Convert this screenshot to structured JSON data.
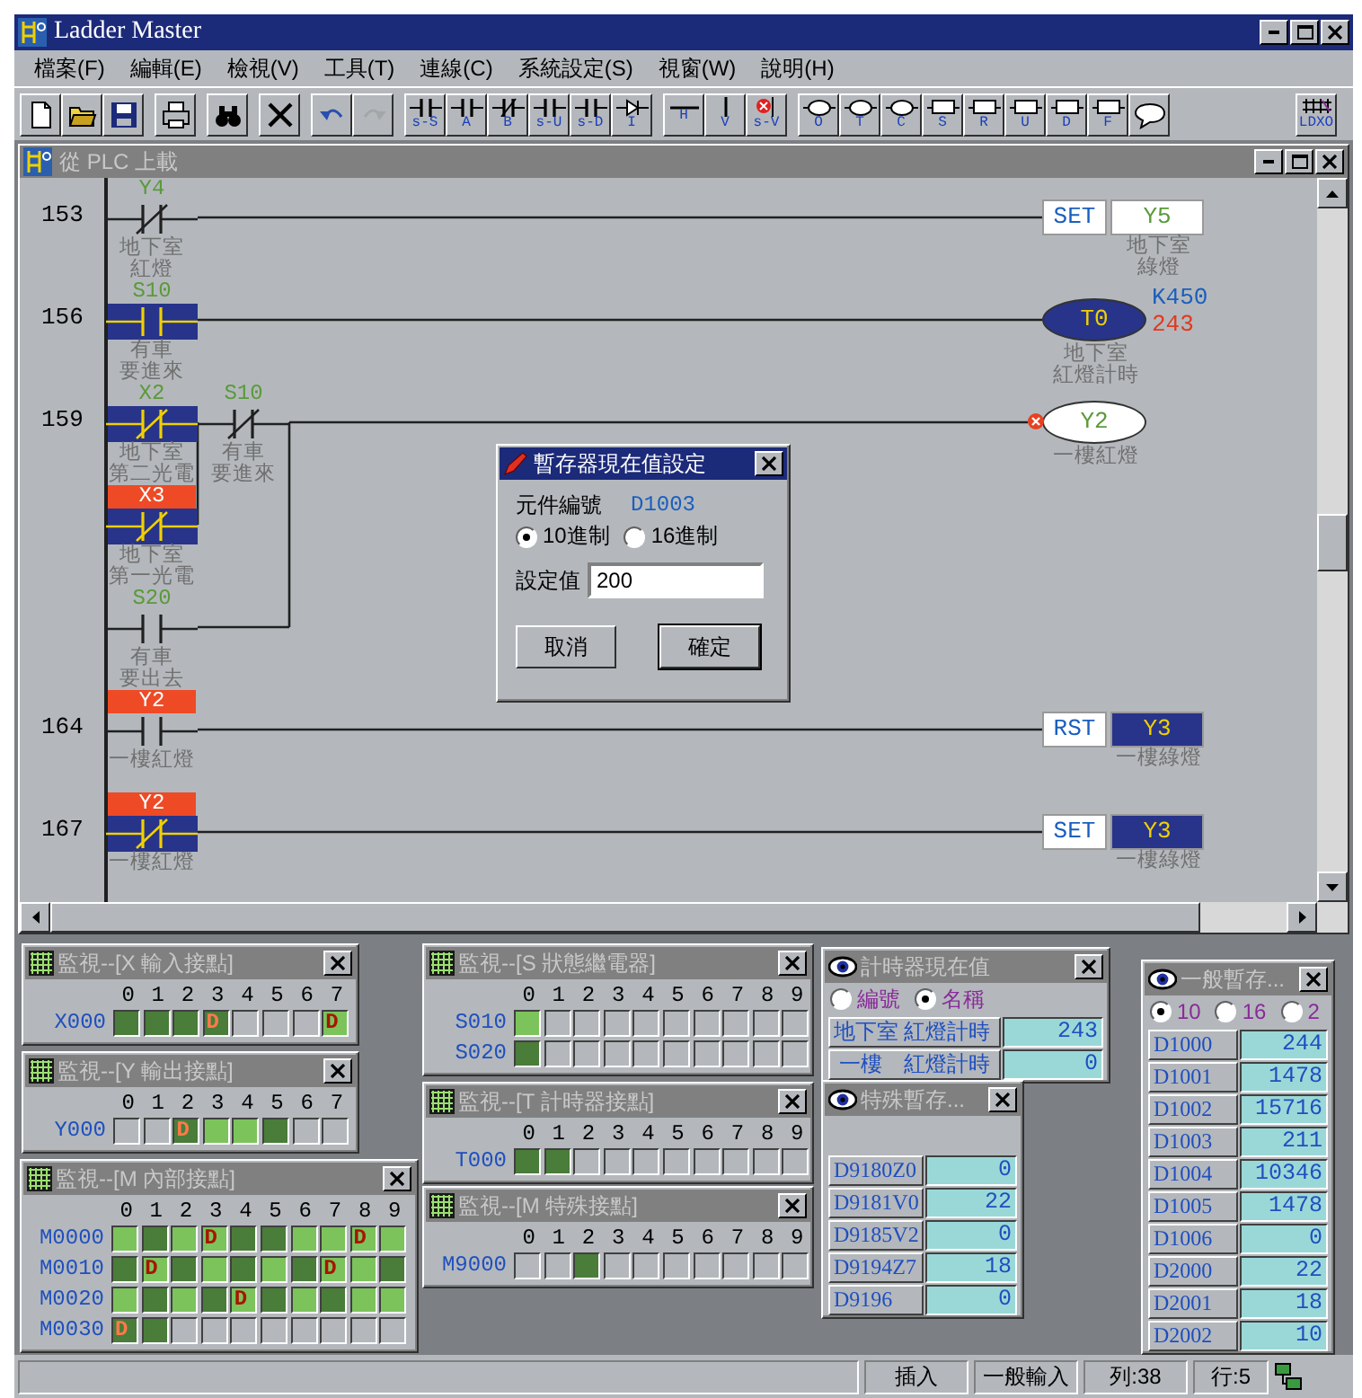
{
  "window": {
    "title": "Ladder Master"
  },
  "menu": [
    "檔案(F)",
    "編輯(E)",
    "檢視(V)",
    "工具(T)",
    "連線(C)",
    "系統設定(S)",
    "視窗(W)",
    "說明(H)"
  ],
  "toolbar": [
    [
      {
        "kind": "new",
        "disabled": false
      },
      {
        "kind": "open",
        "disabled": false
      },
      {
        "kind": "save",
        "disabled": false
      }
    ],
    [
      {
        "kind": "print",
        "disabled": false
      }
    ],
    [
      {
        "kind": "find",
        "disabled": false
      }
    ],
    [
      {
        "kind": "delete",
        "disabled": false
      }
    ],
    [
      {
        "kind": "undo",
        "disabled": false
      },
      {
        "kind": "redo",
        "disabled": true
      }
    ],
    [
      {
        "kind": "contact",
        "label": "s-S",
        "disabled": false
      },
      {
        "kind": "contact",
        "label": "A",
        "disabled": false
      },
      {
        "kind": "contact-nc",
        "label": "B",
        "disabled": false
      },
      {
        "kind": "contact",
        "label": "s-U",
        "disabled": false
      },
      {
        "kind": "contact",
        "label": "s-D",
        "disabled": false
      },
      {
        "kind": "arrow",
        "label": "I",
        "disabled": false
      }
    ],
    [
      {
        "kind": "line-h",
        "label": "H",
        "disabled": false
      },
      {
        "kind": "line-v",
        "label": "V",
        "disabled": false
      },
      {
        "kind": "line-delete",
        "label": "s-V",
        "disabled": false
      }
    ],
    [
      {
        "kind": "coil",
        "label": "O",
        "disabled": false
      },
      {
        "kind": "coil",
        "label": "T",
        "disabled": false
      },
      {
        "kind": "coil",
        "label": "C",
        "disabled": false
      },
      {
        "kind": "box",
        "label": "S",
        "disabled": false
      },
      {
        "kind": "box",
        "label": "R",
        "disabled": false
      },
      {
        "kind": "box",
        "label": "U",
        "disabled": false
      },
      {
        "kind": "box",
        "label": "D",
        "disabled": false
      },
      {
        "kind": "box",
        "label": "F",
        "disabled": false
      },
      {
        "kind": "comment",
        "disabled": false
      }
    ],
    [
      {
        "kind": "ldxo",
        "label": "LDXO",
        "disabled": false
      }
    ]
  ],
  "child_window": {
    "title": "從 PLC 上載"
  },
  "ladder": {
    "rungs": [
      {
        "step": "153",
        "logic": {
          "kind": "contact-nc",
          "device": "Y4",
          "label_on": false,
          "energized": false,
          "comment": [
            "地下室",
            "紅燈"
          ]
        },
        "output": {
          "kind": "instruction",
          "instruction": "SET",
          "device": "Y5",
          "energized": false,
          "comment": [
            "地下室",
            "綠燈"
          ]
        }
      },
      {
        "step": "156",
        "logic": {
          "kind": "contact-no",
          "device": "S10",
          "label_on": false,
          "energized": true,
          "comment": [
            "有車",
            "要進來"
          ]
        },
        "output": {
          "kind": "timer",
          "device": "T0",
          "energized": true,
          "preset": "K450",
          "current": "243",
          "comment": [
            "地下室",
            "紅燈計時"
          ]
        }
      },
      {
        "step": "159",
        "logic": {
          "kind": "parallel",
          "items": [
            {
              "kind": "series",
              "items": [
                {
                  "kind": "parallel",
                  "items": [
                    {
                      "kind": "contact-nc",
                      "device": "X2",
                      "label_on": false,
                      "energized": true,
                      "comment": [
                        "地下室",
                        "第二光電"
                      ]
                    },
                    {
                      "kind": "contact-nc",
                      "device": "X3",
                      "label_on": true,
                      "energized": true,
                      "comment": [
                        "地下室",
                        "第一光電"
                      ]
                    }
                  ]
                },
                {
                  "kind": "contact-nc",
                  "device": "S10",
                  "label_on": false,
                  "energized": false,
                  "comment": [
                    "有車",
                    "要進來"
                  ]
                }
              ]
            },
            {
              "kind": "contact-no",
              "device": "S20",
              "label_on": false,
              "energized": false,
              "comment": [
                "有車",
                "要出去"
              ]
            }
          ]
        },
        "output": {
          "kind": "coil",
          "device": "Y2",
          "energized": false,
          "fault": true,
          "comment": [
            "一樓紅燈"
          ]
        }
      },
      {
        "step": "164",
        "logic": {
          "kind": "contact-no",
          "device": "Y2",
          "label_on": true,
          "energized": false,
          "comment": [
            "一樓紅燈"
          ]
        },
        "output": {
          "kind": "instruction",
          "instruction": "RST",
          "device": "Y3",
          "energized": true,
          "comment": [
            "一樓綠燈"
          ]
        }
      },
      {
        "step": "167",
        "logic": {
          "kind": "contact-nc",
          "device": "Y2",
          "label_on": true,
          "energized": true,
          "comment": [
            "一樓紅燈"
          ]
        },
        "output": {
          "kind": "instruction",
          "instruction": "SET",
          "device": "Y3",
          "energized": true,
          "comment": [
            "一樓綠燈"
          ]
        }
      }
    ]
  },
  "dialog": {
    "title": "暫存器現在值設定",
    "device_label": "元件編號",
    "device": "D1003",
    "options": [
      {
        "label": "10進制",
        "selected": true
      },
      {
        "label": "16進制",
        "selected": false
      }
    ],
    "value_label": "設定值",
    "value": "200",
    "buttons": [
      {
        "label": "取消",
        "default": false
      },
      {
        "label": "確定",
        "default": true
      }
    ]
  },
  "monitors": [
    {
      "kind": "bits",
      "title": "監視--[X 輸入接點]",
      "columns": [
        "0",
        "1",
        "2",
        "3",
        "4",
        "5",
        "6",
        "7"
      ],
      "rows": [
        {
          "address": "X000",
          "cells": [
            {
              "on": true,
              "color": "#4a7c3a"
            },
            {
              "on": true,
              "color": "#4a7c3a"
            },
            {
              "on": true,
              "color": "#4a7c3a"
            },
            {
              "on": true,
              "color": "#4a7c3a",
              "text": "D"
            },
            {
              "on": false
            },
            {
              "on": false
            },
            {
              "on": false
            },
            {
              "on": true,
              "color": "#7cc35c",
              "text": "D"
            }
          ]
        }
      ]
    },
    {
      "kind": "bits",
      "title": "監視--[Y 輸出接點]",
      "columns": [
        "0",
        "1",
        "2",
        "3",
        "4",
        "5",
        "6",
        "7"
      ],
      "rows": [
        {
          "address": "Y000",
          "cells": [
            {
              "on": false
            },
            {
              "on": false
            },
            {
              "on": true,
              "color": "#4a7c3a",
              "text": "D"
            },
            {
              "on": true,
              "color": "#7cc35c"
            },
            {
              "on": true,
              "color": "#7cc35c"
            },
            {
              "on": true,
              "color": "#4a7c3a"
            },
            {
              "on": false
            },
            {
              "on": false
            }
          ]
        }
      ]
    },
    {
      "kind": "bits",
      "title": "監視--[M 內部接點]",
      "columns": [
        "0",
        "1",
        "2",
        "3",
        "4",
        "5",
        "6",
        "7",
        "8",
        "9"
      ],
      "rows": [
        {
          "address": "M0000",
          "cells": [
            {
              "on": true,
              "color": "#7cc35c"
            },
            {
              "on": true,
              "color": "#4a7c3a"
            },
            {
              "on": true,
              "color": "#7cc35c"
            },
            {
              "on": true,
              "color": "#7cc35c",
              "text": "D"
            },
            {
              "on": true,
              "color": "#4a7c3a"
            },
            {
              "on": true,
              "color": "#4a7c3a"
            },
            {
              "on": true,
              "color": "#7cc35c"
            },
            {
              "on": true,
              "color": "#7cc35c"
            },
            {
              "on": true,
              "color": "#7cc35c",
              "text": "D"
            },
            {
              "on": true,
              "color": "#7cc35c"
            }
          ]
        },
        {
          "address": "M0010",
          "cells": [
            {
              "on": true,
              "color": "#4a7c3a"
            },
            {
              "on": true,
              "color": "#7cc35c",
              "text": "D"
            },
            {
              "on": true,
              "color": "#4a7c3a"
            },
            {
              "on": true,
              "color": "#7cc35c"
            },
            {
              "on": true,
              "color": "#4a7c3a"
            },
            {
              "on": true,
              "color": "#7cc35c"
            },
            {
              "on": true,
              "color": "#4a7c3a"
            },
            {
              "on": true,
              "color": "#7cc35c",
              "text": "D"
            },
            {
              "on": true,
              "color": "#7cc35c"
            },
            {
              "on": true,
              "color": "#4a7c3a"
            }
          ]
        },
        {
          "address": "M0020",
          "cells": [
            {
              "on": true,
              "color": "#7cc35c"
            },
            {
              "on": true,
              "color": "#4a7c3a"
            },
            {
              "on": true,
              "color": "#7cc35c"
            },
            {
              "on": true,
              "color": "#4a7c3a"
            },
            {
              "on": true,
              "color": "#7cc35c",
              "text": "D"
            },
            {
              "on": true,
              "color": "#4a7c3a"
            },
            {
              "on": true,
              "color": "#7cc35c"
            },
            {
              "on": true,
              "color": "#4a7c3a"
            },
            {
              "on": true,
              "color": "#7cc35c"
            },
            {
              "on": true,
              "color": "#7cc35c"
            }
          ]
        },
        {
          "address": "M0030",
          "cells": [
            {
              "on": true,
              "color": "#4a7c3a",
              "text": "D"
            },
            {
              "on": true,
              "color": "#4a7c3a"
            },
            {
              "on": false
            },
            {
              "on": false
            },
            {
              "on": false
            },
            {
              "on": false
            },
            {
              "on": false
            },
            {
              "on": false
            },
            {
              "on": false
            },
            {
              "on": false
            }
          ]
        }
      ]
    },
    {
      "kind": "bits",
      "title": "監視--[S 狀態繼電器]",
      "columns": [
        "0",
        "1",
        "2",
        "3",
        "4",
        "5",
        "6",
        "7",
        "8",
        "9"
      ],
      "rows": [
        {
          "address": "S010",
          "cells": [
            {
              "on": true,
              "color": "#7cc35c"
            },
            {
              "on": false
            },
            {
              "on": false
            },
            {
              "on": false
            },
            {
              "on": false
            },
            {
              "on": false
            },
            {
              "on": false
            },
            {
              "on": false
            },
            {
              "on": false
            },
            {
              "on": false
            }
          ]
        },
        {
          "address": "S020",
          "cells": [
            {
              "on": true,
              "color": "#4a7c3a"
            },
            {
              "on": false
            },
            {
              "on": false
            },
            {
              "on": false
            },
            {
              "on": false
            },
            {
              "on": false
            },
            {
              "on": false
            },
            {
              "on": false
            },
            {
              "on": false
            },
            {
              "on": false
            }
          ]
        }
      ]
    },
    {
      "kind": "bits",
      "title": "監視--[T 計時器接點]",
      "columns": [
        "0",
        "1",
        "2",
        "3",
        "4",
        "5",
        "6",
        "7",
        "8",
        "9"
      ],
      "rows": [
        {
          "address": "T000",
          "cells": [
            {
              "on": true,
              "color": "#4a7c3a"
            },
            {
              "on": true,
              "color": "#4a7c3a"
            },
            {
              "on": false
            },
            {
              "on": false
            },
            {
              "on": false
            },
            {
              "on": false
            },
            {
              "on": false
            },
            {
              "on": false
            },
            {
              "on": false
            },
            {
              "on": false
            }
          ]
        }
      ]
    },
    {
      "kind": "bits",
      "title": "監視--[M 特殊接點]",
      "columns": [
        "0",
        "1",
        "2",
        "3",
        "4",
        "5",
        "6",
        "7",
        "8",
        "9"
      ],
      "rows": [
        {
          "address": "M9000",
          "cells": [
            {
              "on": false
            },
            {
              "on": false
            },
            {
              "on": true,
              "color": "#4a7c3a"
            },
            {
              "on": false
            },
            {
              "on": false
            },
            {
              "on": false
            },
            {
              "on": false
            },
            {
              "on": false
            },
            {
              "on": false
            },
            {
              "on": false
            }
          ]
        }
      ]
    },
    {
      "kind": "timers",
      "title": "計時器現在值",
      "options": [
        {
          "label": "編號",
          "selected": false
        },
        {
          "label": "名稱",
          "selected": true
        }
      ],
      "rows": [
        {
          "name": "地下室 紅燈計時",
          "value": "243"
        },
        {
          "name": " 一樓　紅燈計時",
          "value": "0"
        }
      ]
    },
    {
      "kind": "registers",
      "title": "特殊暫存...",
      "rows": [
        {
          "name": "D9180Z0",
          "value": "0"
        },
        {
          "name": "D9181V0",
          "value": "22"
        },
        {
          "name": "D9185V2",
          "value": "0"
        },
        {
          "name": "D9194Z7",
          "value": "18"
        },
        {
          "name": "D9196",
          "value": "0"
        }
      ]
    },
    {
      "kind": "registers",
      "title": "一般暫存...",
      "options": [
        {
          "label": "10",
          "selected": true
        },
        {
          "label": "16",
          "selected": false
        },
        {
          "label": "2",
          "selected": false
        }
      ],
      "rows": [
        {
          "name": "D1000",
          "value": "244"
        },
        {
          "name": "D1001",
          "value": "1478"
        },
        {
          "name": "D1002",
          "value": "15716"
        },
        {
          "name": "D1003",
          "value": "211"
        },
        {
          "name": "D1004",
          "value": "10346"
        },
        {
          "name": "D1005",
          "value": "1478"
        },
        {
          "name": "D1006",
          "value": "0"
        },
        {
          "name": "D2000",
          "value": "22"
        },
        {
          "name": "D2001",
          "value": "18"
        },
        {
          "name": "D2002",
          "value": "10"
        }
      ]
    }
  ],
  "status_bar": [
    "插入",
    "一般輸入",
    "列:38",
    "行:5"
  ]
}
